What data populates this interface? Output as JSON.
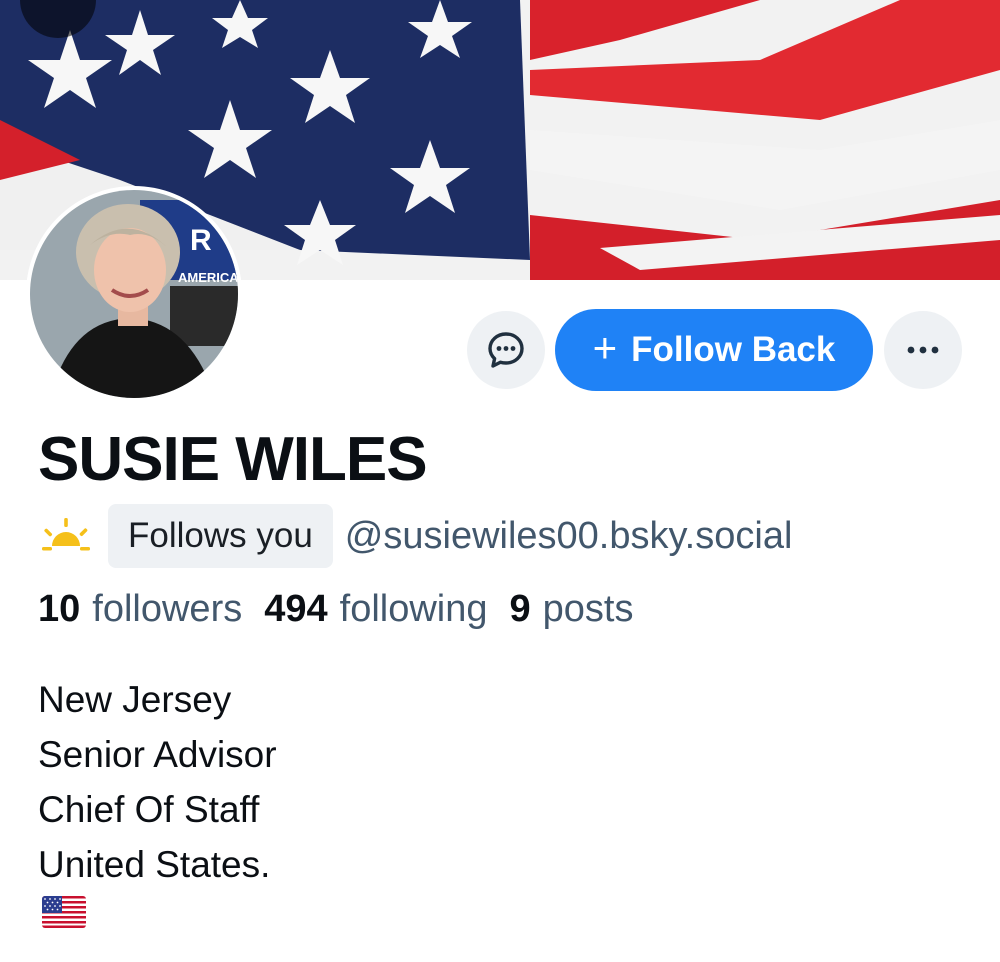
{
  "profile": {
    "display_name": "SUSIE WILES",
    "follows_you_label": "Follows you",
    "handle": "@susiewiles00.bsky.social",
    "avatar_sign_text": "AMERICA",
    "stats": {
      "followers_count": "10",
      "followers_label": "followers",
      "following_count": "494",
      "following_label": "following",
      "posts_count": "9",
      "posts_label": "posts"
    },
    "bio_lines": [
      "New Jersey",
      "Senior Advisor",
      "Chief Of Staff",
      "United States."
    ],
    "bio_emoji": "us-flag-emoji"
  },
  "actions": {
    "message_icon": "chat-bubble-icon",
    "follow_back_label": "Follow Back",
    "follow_icon": "plus-icon",
    "more_icon": "ellipsis-icon"
  },
  "colors": {
    "accent": "#1f82f6",
    "muted_text": "#42576c",
    "badge_bg": "#eef1f4"
  }
}
